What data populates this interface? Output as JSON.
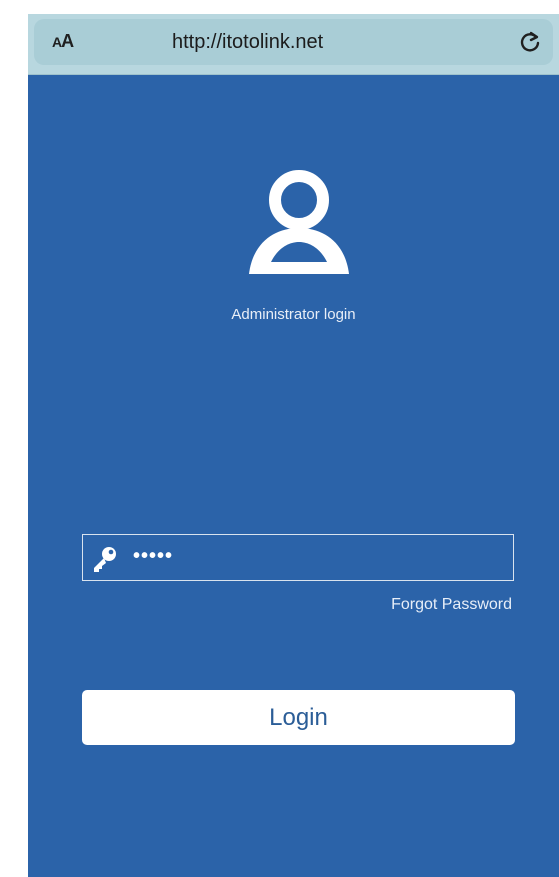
{
  "browser": {
    "text_size_label": "AA",
    "url": "http://itotolink.net",
    "reload_icon": "reload-icon"
  },
  "page": {
    "background": "#2b63a9",
    "avatar_icon": "user-avatar-icon",
    "admin_label": "Administrator login",
    "password": {
      "icon": "key-icon",
      "value": "•••••"
    },
    "forgot_password": "Forgot Password",
    "login_button": "Login"
  }
}
